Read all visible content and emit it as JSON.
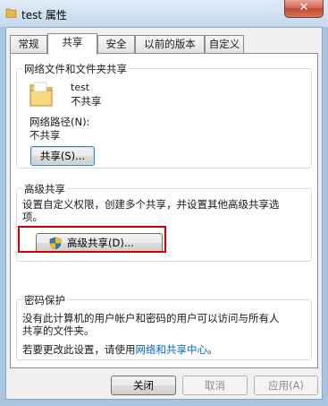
{
  "window": {
    "title": "test 属性",
    "close_symbol": "✕"
  },
  "tabs": [
    {
      "label": "常规"
    },
    {
      "label": "共享"
    },
    {
      "label": "安全"
    },
    {
      "label": "以前的版本"
    },
    {
      "label": "自定义"
    }
  ],
  "network_share": {
    "legend": "网络文件和文件夹共享",
    "folder_name": "test",
    "folder_status": "不共享",
    "path_label": "网络路径(N):",
    "path_value": "不共享",
    "share_button": "共享(S)..."
  },
  "advanced_share": {
    "legend": "高级共享",
    "description_line1": "设置自定义权限，创建多个共享，并设置其他高级共享选",
    "description_line2": "项。",
    "button": "高级共享(D)..."
  },
  "password": {
    "legend": "密码保护",
    "line1": "没有此计算机的用户帐户和密码的用户可以访问与所有人",
    "line2": "共享的文件夹。",
    "change_prefix": "若要更改此设置，请使用",
    "link": "网络和共享中心",
    "change_suffix": "。"
  },
  "footer": {
    "close_button": "关闭",
    "cancel_button": "取消",
    "apply_button": "应用(A)"
  }
}
